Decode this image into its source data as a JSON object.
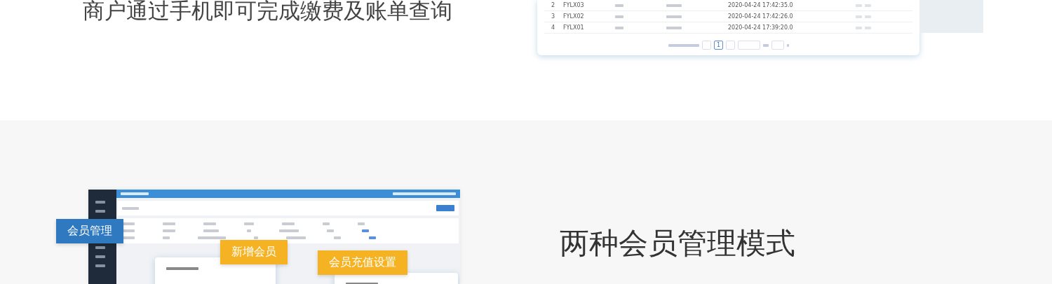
{
  "intro": {
    "subtitle": "商户通过手机即可完成缴费及账单查询"
  },
  "bill_table": {
    "rows": [
      {
        "no": "2",
        "code": "FYLX03",
        "time": "2020-04-24 17:42:35.0"
      },
      {
        "no": "3",
        "code": "FYLX02",
        "time": "2020-04-24 17:42:26.0"
      },
      {
        "no": "4",
        "code": "FYLX01",
        "time": "2020-04-24 17:39:20.0"
      }
    ],
    "pagination": {
      "current_page": "1"
    }
  },
  "member_section": {
    "heading": "两种会员管理模式",
    "callouts": [
      {
        "label": "会员管理",
        "color": "#2f79c1"
      },
      {
        "label": "新增会员",
        "color": "#f5b324"
      },
      {
        "label": "会员充值设置",
        "color": "#f5b324"
      }
    ]
  }
}
